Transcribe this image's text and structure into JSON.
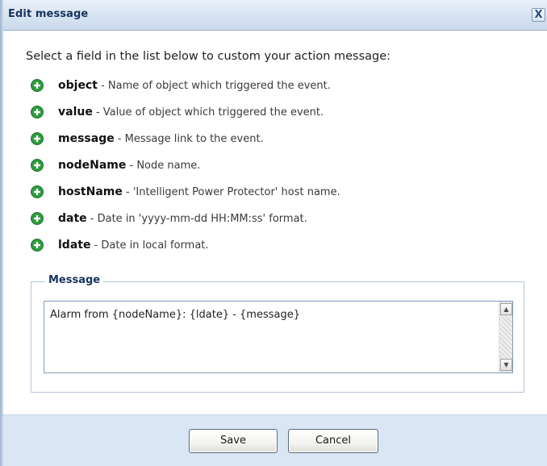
{
  "dialog": {
    "title": "Edit message",
    "close_label": "X"
  },
  "instructions": "Select a field in the list below to custom your action message:",
  "fields": [
    {
      "name": "object",
      "description": " - Name of object which triggered the event.",
      "icon": "plus-circle-icon"
    },
    {
      "name": "value",
      "description": " - Value of object which triggered the event.",
      "icon": "plus-circle-icon"
    },
    {
      "name": "message",
      "description": " - Message link to the event.",
      "icon": "plus-circle-icon"
    },
    {
      "name": "nodeName",
      "description": " - Node name.",
      "icon": "plus-circle-icon"
    },
    {
      "name": "hostName",
      "description": " - 'Intelligent Power Protector' host name.",
      "icon": "plus-circle-icon"
    },
    {
      "name": "date",
      "description": " - Date in 'yyyy-mm-dd HH:MM:ss' format.",
      "icon": "plus-circle-icon"
    },
    {
      "name": "ldate",
      "description": " - Date in local format.",
      "icon": "plus-circle-icon"
    }
  ],
  "message_group": {
    "legend": "Message",
    "value": "Alarm from {nodeName}: {ldate} - {message}"
  },
  "buttons": {
    "save": "Save",
    "cancel": "Cancel"
  },
  "colors": {
    "icon_green": "#2e9a3f",
    "title_text": "#17345e",
    "footer_bg": "#dbe6f4"
  }
}
